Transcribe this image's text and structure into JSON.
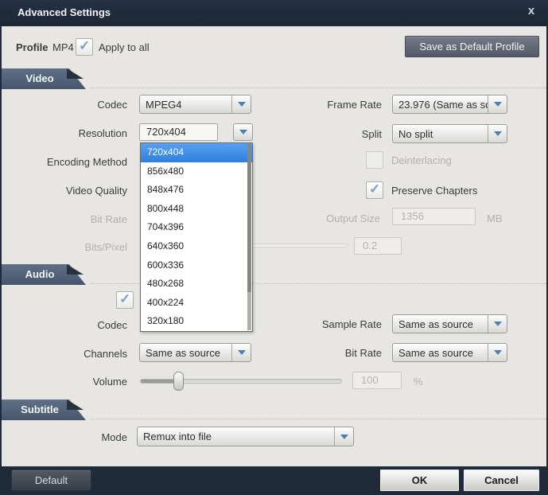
{
  "titlebar": {
    "title": "Advanced Settings",
    "close_glyph": "x"
  },
  "profile": {
    "label": "Profile",
    "value": "MP4",
    "apply_to_all_label": "Apply to all",
    "apply_to_all_checked": true,
    "save_button": "Save as Default Profile"
  },
  "sections": {
    "video": "Video",
    "audio": "Audio",
    "subtitle": "Subtitle"
  },
  "video": {
    "codec_label": "Codec",
    "codec_value": "MPEG4",
    "frame_rate_label": "Frame Rate",
    "frame_rate_value": "23.976 (Same as so",
    "resolution_label": "Resolution",
    "resolution_value": "720x404",
    "split_label": "Split",
    "split_value": "No split",
    "encoding_method_label": "Encoding Method",
    "deinterlacing_label": "Deinterlacing",
    "deinterlacing_enabled": false,
    "video_quality_label": "Video Quality",
    "preserve_chapters_label": "Preserve Chapters",
    "preserve_chapters_checked": true,
    "bit_rate_label": "Bit Rate",
    "output_size_label": "Output Size",
    "output_size_value": "1356",
    "output_size_unit": "MB",
    "bits_pixel_label": "Bits/Pixel",
    "bits_pixel_value": "0.2"
  },
  "resolution_dropdown": {
    "selected": "720x404",
    "options": [
      "720x404",
      "856x480",
      "848x476",
      "800x448",
      "704x396",
      "640x360",
      "600x336",
      "480x268",
      "400x224",
      "320x180"
    ]
  },
  "audio": {
    "enabled_checked": true,
    "codec_label": "Codec",
    "sample_rate_label": "Sample Rate",
    "sample_rate_value": "Same as source",
    "channels_label": "Channels",
    "channels_value": "Same as source",
    "bit_rate_label": "Bit Rate",
    "bit_rate_value": "Same as source",
    "volume_label": "Volume",
    "volume_value": "100",
    "volume_unit": "%",
    "volume_percent_position": 20
  },
  "subtitle": {
    "mode_label": "Mode",
    "mode_value": "Remux into file"
  },
  "footer": {
    "default_button": "Default",
    "ok_button": "OK",
    "cancel_button": "Cancel"
  },
  "icons": {
    "check": "✓",
    "dropdown_arrow": "chevron-down"
  },
  "colors": {
    "titlebar_bg": "#1f2a39",
    "body_bg": "#e7e6e3",
    "section_tab": "#51617a",
    "selected_item_blue": "#3788e4",
    "check_blue": "#7aa0c4",
    "arrow_blue": "#4d80b0"
  }
}
